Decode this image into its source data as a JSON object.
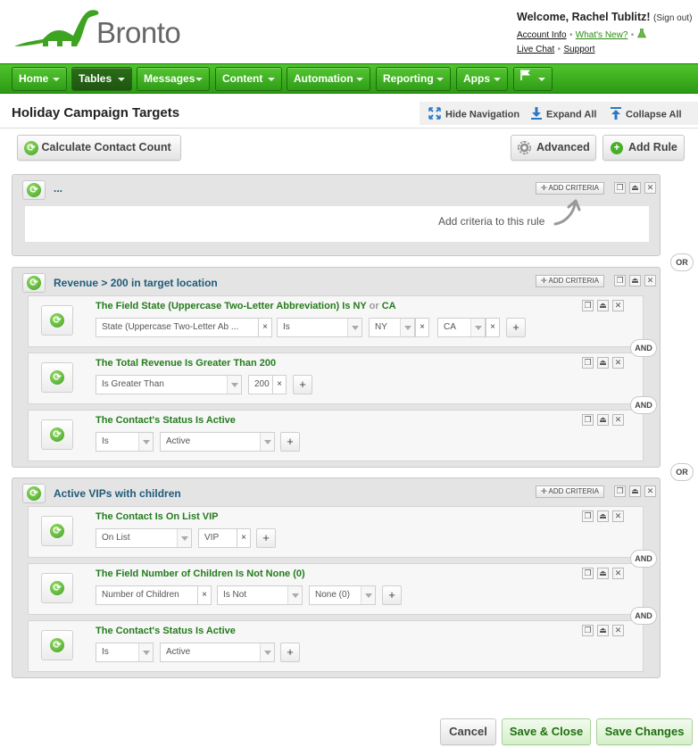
{
  "brand": {
    "name": "Bronto"
  },
  "user": {
    "welcome": "Welcome, Rachel Tublitz!",
    "sign_out": "(Sign out)",
    "links": [
      "Account Info",
      "What's New?",
      "Live Chat",
      "Support"
    ]
  },
  "nav": {
    "items": [
      "Home",
      "Tables",
      "Messages",
      "Content",
      "Automation",
      "Reporting",
      "Apps",
      ""
    ],
    "active": "Tables"
  },
  "page": {
    "title": "Holiday Campaign Targets"
  },
  "toolbar": {
    "hide_navigation": "Hide Navigation",
    "expand_all": "Expand All",
    "collapse_all": "Collapse All"
  },
  "actions": {
    "calculate": "Calculate Contact Count",
    "advanced": "Advanced",
    "add_rule": "Add Rule"
  },
  "rules": [
    {
      "title": "...",
      "add_criteria": "ADD CRITERIA",
      "empty_hint": "Add criteria to this rule"
    },
    {
      "title": "Revenue > 200 in target location",
      "add_criteria": "ADD CRITERIA",
      "criteria": [
        {
          "title_a": "The Field State (Uppercase Two-Letter Abbreviation) Is NY ",
          "title_or": "or",
          "title_b": " CA",
          "fields": [
            "State (Uppercase Two-Letter Ab ...",
            "Is",
            "NY",
            "CA"
          ]
        },
        {
          "title": "The Total Revenue Is Greater Than 200",
          "fields": [
            "Is Greater Than",
            "200"
          ]
        },
        {
          "title": "The Contact's Status Is Active",
          "fields": [
            "Is",
            "Active"
          ]
        }
      ]
    },
    {
      "title": "Active VIPs with children",
      "add_criteria": "ADD CRITERIA",
      "criteria": [
        {
          "title": "The Contact Is On List VIP",
          "fields": [
            "On List",
            "VIP"
          ]
        },
        {
          "title": "The Field Number of Children Is Not None (0)",
          "fields": [
            "Number of Children",
            "Is Not",
            "None (0)"
          ]
        },
        {
          "title": "The Contact's Status Is Active",
          "fields": [
            "Is",
            "Active"
          ]
        }
      ]
    }
  ],
  "connectors": {
    "or": "OR",
    "and": "AND"
  },
  "footer": {
    "cancel": "Cancel",
    "save_close": "Save & Close",
    "save_changes": "Save Changes"
  }
}
